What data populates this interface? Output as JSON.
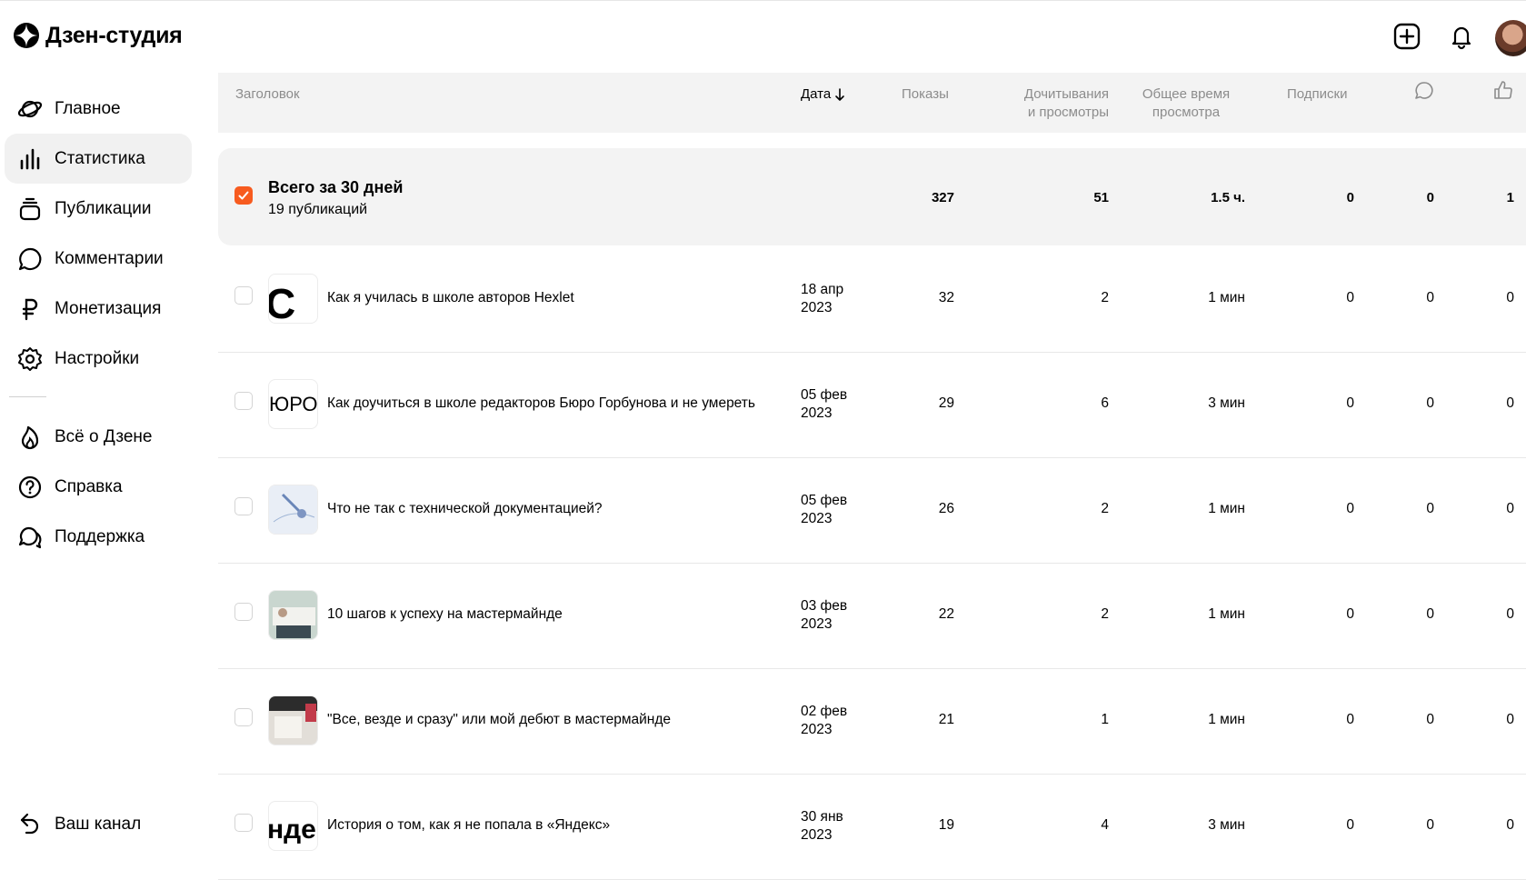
{
  "app": {
    "title": "Дзен-студия"
  },
  "header": {
    "create_icon": "plus-square-icon",
    "notifications_icon": "bell-icon"
  },
  "sidebar": {
    "items": [
      {
        "label": "Главное",
        "icon": "planet-icon",
        "active": false
      },
      {
        "label": "Статистика",
        "icon": "bar-chart-icon",
        "active": true
      },
      {
        "label": "Публикации",
        "icon": "stack-icon",
        "active": false
      },
      {
        "label": "Комментарии",
        "icon": "comment-icon",
        "active": false
      },
      {
        "label": "Монетизация",
        "icon": "ruble-icon",
        "active": false
      },
      {
        "label": "Настройки",
        "icon": "gear-icon",
        "active": false
      }
    ],
    "secondary": [
      {
        "label": "Всё о Дзене",
        "icon": "flame-icon"
      },
      {
        "label": "Справка",
        "icon": "question-icon"
      },
      {
        "label": "Поддержка",
        "icon": "chat-icon"
      }
    ],
    "channel": {
      "label": "Ваш канал",
      "icon": "back-arrow-icon"
    }
  },
  "table": {
    "columns": {
      "title": "Заголовок",
      "date": "Дата",
      "views": "Показы",
      "reads_1": "Дочитывания",
      "reads_2": "и просмотры",
      "time_1": "Общее время",
      "time_2": "просмотра",
      "subs": "Подписки",
      "comments_icon": "comment-icon",
      "likes_icon": "thumbs-up-icon"
    },
    "total": {
      "title": "Всего за 30 дней",
      "subtitle": "19 публикаций",
      "views": "327",
      "reads": "51",
      "time": "1.5 ч.",
      "subs": "0",
      "comments": "0",
      "likes": "1"
    },
    "rows": [
      {
        "title": "Как я училась в школе авторов Hexlet",
        "date_line1": "18 апр",
        "date_line2": "2023",
        "views": "32",
        "reads": "2",
        "time": "1 мин",
        "subs": "0",
        "comments": "0",
        "likes": "0"
      },
      {
        "title": "Как доучиться в школе редакторов Бюро Горбунова и не умереть",
        "date_line1": "05 фев",
        "date_line2": "2023",
        "views": "29",
        "reads": "6",
        "time": "3 мин",
        "subs": "0",
        "comments": "0",
        "likes": "0"
      },
      {
        "title": "Что не так с технической документацией?",
        "date_line1": "05 фев",
        "date_line2": "2023",
        "views": "26",
        "reads": "2",
        "time": "1 мин",
        "subs": "0",
        "comments": "0",
        "likes": "0"
      },
      {
        "title": "10 шагов к успеху на мастермайнде",
        "date_line1": "03 фев",
        "date_line2": "2023",
        "views": "22",
        "reads": "2",
        "time": "1 мин",
        "subs": "0",
        "comments": "0",
        "likes": "0"
      },
      {
        "title": "\"Все, везде и сразу\" или мой дебют в мастермайнде",
        "date_line1": "02 фев",
        "date_line2": "2023",
        "views": "21",
        "reads": "1",
        "time": "1 мин",
        "subs": "0",
        "comments": "0",
        "likes": "0"
      },
      {
        "title": "История о том, как я не попала в «Яндекс»",
        "date_line1": "30 янв",
        "date_line2": "2023",
        "views": "19",
        "reads": "4",
        "time": "3 мин",
        "subs": "0",
        "comments": "0",
        "likes": "0"
      }
    ],
    "thumb_texts": [
      "C",
      "ЮРО",
      "",
      "",
      "",
      "ндеl"
    ]
  },
  "colors": {
    "accent": "#f75b1f",
    "header_bg": "#f3f3f3",
    "active_nav": "#f1f1f1"
  }
}
